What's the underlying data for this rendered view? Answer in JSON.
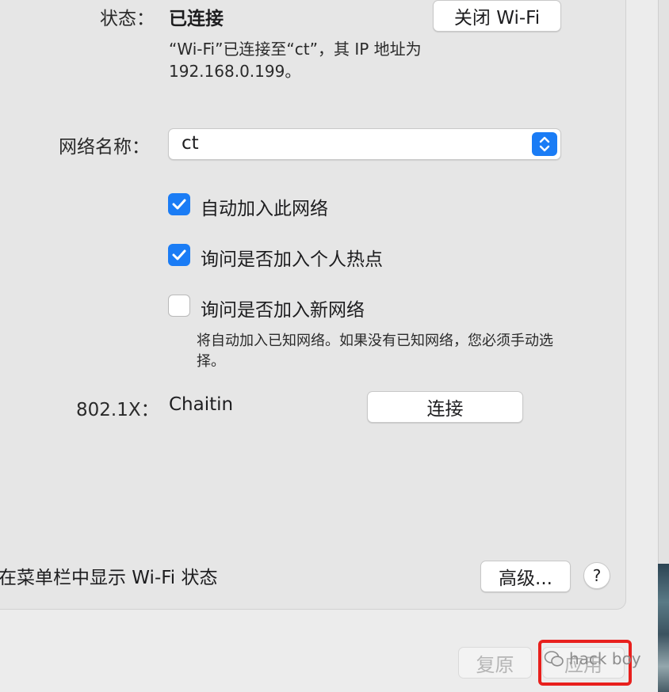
{
  "status": {
    "label": "状态：",
    "value": "已连接",
    "button_label": "关闭 Wi-Fi",
    "info": "“Wi-Fi”已连接至“ct”，其 IP 地址为 192.168.0.199。"
  },
  "network_name": {
    "label": "网络名称：",
    "value": "ct"
  },
  "options": [
    {
      "label": "自动加入此网络",
      "checked": true
    },
    {
      "label": "询问是否加入个人热点",
      "checked": true
    },
    {
      "label": "询问是否加入新网络",
      "checked": false
    }
  ],
  "new_network_info": "将自动加入已知网络。如果没有已知网络，您必须手动选择。",
  "dot1x": {
    "label": "802.1X：",
    "value": "Chaitin",
    "button_label": "连接"
  },
  "menubar_option": {
    "label": "在菜单栏中显示 Wi-Fi 状态"
  },
  "advanced_button": "高级...",
  "help_button": "?",
  "footer": {
    "revert_label": "复原",
    "apply_label": "应用"
  },
  "watermark": "hack boy",
  "colors": {
    "accent": "#1a7cf5",
    "highlight": "#e8201d"
  }
}
